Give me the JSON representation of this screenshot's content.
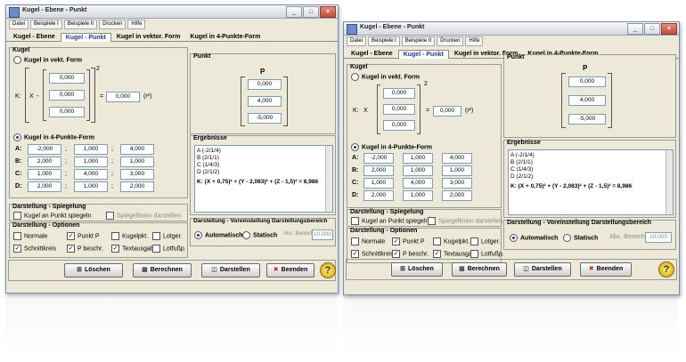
{
  "front": {
    "title": "Kugel - Ebene - Punkt",
    "menu": [
      "Datei",
      "Beispiele I",
      "Beispiele II",
      "Drucken",
      "Hilfe"
    ],
    "tabs": [
      "Kugel - Ebene",
      "Kugel - Punkt",
      "Kugel in vektor. Form",
      "Kugel in 4-Punkte-Form"
    ],
    "kugel": {
      "title": "Kugel",
      "radio_vekt": "Kugel in vekt. Form",
      "xlabel": "K:",
      "xvec": "X",
      "center": [
        "0,000",
        "0,000",
        "0,000"
      ],
      "radius": "0,000",
      "rsq": "(r²)",
      "minus": "-",
      "eq": "=",
      "sup": "2",
      "radio_4p": "Kugel in 4-Punkte-Form",
      "rows": [
        {
          "label": "A:",
          "v": [
            "-2,000",
            "1,000",
            "4,000"
          ]
        },
        {
          "label": "B:",
          "v": [
            "2,000",
            "1,000",
            "1,000"
          ]
        },
        {
          "label": "C:",
          "v": [
            "1,000",
            "4,000",
            "3,000"
          ]
        },
        {
          "label": "D:",
          "v": [
            "2,000",
            "1,000",
            "2,000"
          ]
        }
      ],
      "sep": ";"
    },
    "punkt": {
      "title": "Punkt",
      "name": "P",
      "v": [
        "0,000",
        "4,000",
        "-5,000"
      ]
    },
    "ergebnisse": {
      "title": "Ergebnisse",
      "lines": [
        "A (-2/1/4)",
        "B (2/1/1)",
        "C (1/4/3)",
        "D (2/1/2)"
      ],
      "equation": "K:  (X + 0,75)² + (Y - 2,083)² + (Z - 1,5)² = 8,986"
    },
    "spiegelung": {
      "title": "Darstellung - Spiegelung",
      "check1": "Kugel an Punkt spiegeln",
      "check2": "Spiegellinien darstellen"
    },
    "optionen": {
      "title": "Darstellung - Optionen",
      "items": [
        "Normale",
        "Punkt P",
        "Kugelpkt.",
        "Lotger.",
        "Schnittkreis",
        "P beschr.",
        "Textausgabe",
        "Lotfußp."
      ],
      "checked": [
        false,
        true,
        false,
        false,
        true,
        true,
        true,
        false
      ]
    },
    "bereich": {
      "title": "Darstellung - Voreinstellung Darstellungsbereich",
      "auto": "Automatisch",
      "stat": "Statisch",
      "abs_label": "Abs. Bereich:",
      "abs_value": "10,000"
    },
    "buttons": [
      "Löschen",
      "Berechnen",
      "Darstellen",
      "Beenden"
    ],
    "help": "?"
  },
  "back": {
    "title": "Kugel - Ebene - Punkt",
    "menu": [
      "Datei",
      "Beispiele I",
      "Beispiele II",
      "Drucken",
      "Hilfe"
    ],
    "tabs": [
      "Kugel - Ebene",
      "Kugel - Punkt",
      "Kugel in vektor. Form",
      "Kugel in 4-Punkte-Form"
    ]
  }
}
